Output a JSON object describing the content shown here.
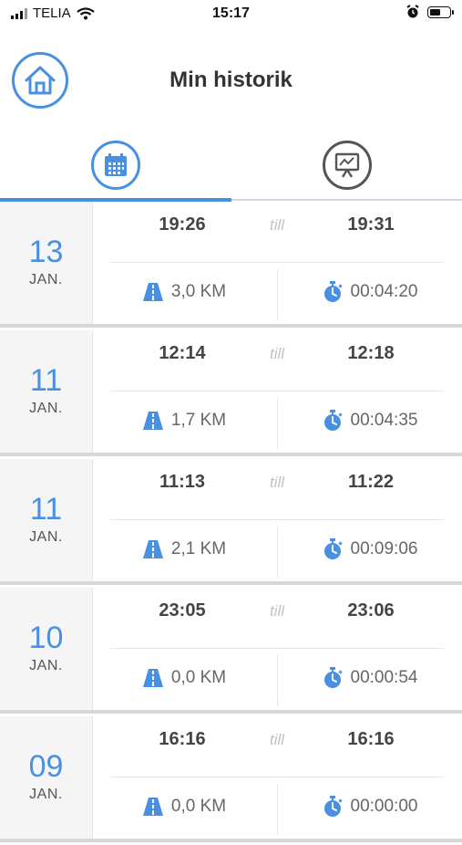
{
  "status": {
    "carrier": "TELIA",
    "time": "15:17"
  },
  "header": {
    "title": "Min historik"
  },
  "tabs": [
    {
      "name": "calendar-icon",
      "selected": true
    },
    {
      "name": "presentation-chart-icon",
      "selected": false
    }
  ],
  "trips": [
    {
      "day": "13",
      "month": "JAN.",
      "start": "19:26",
      "sep": "till",
      "end": "19:31",
      "distance": "3,0 KM",
      "duration": "00:04:20"
    },
    {
      "day": "11",
      "month": "JAN.",
      "start": "12:14",
      "sep": "till",
      "end": "12:18",
      "distance": "1,7 KM",
      "duration": "00:04:35"
    },
    {
      "day": "11",
      "month": "JAN.",
      "start": "11:13",
      "sep": "till",
      "end": "11:22",
      "distance": "2,1 KM",
      "duration": "00:09:06"
    },
    {
      "day": "10",
      "month": "JAN.",
      "start": "23:05",
      "sep": "till",
      "end": "23:06",
      "distance": "0,0 KM",
      "duration": "00:00:54"
    },
    {
      "day": "09",
      "month": "JAN.",
      "start": "16:16",
      "sep": "till",
      "end": "16:16",
      "distance": "0,0 KM",
      "duration": "00:00:00"
    }
  ],
  "colors": {
    "accent": "#4a90e2",
    "text": "#333333",
    "muted": "#c2c2c2"
  }
}
